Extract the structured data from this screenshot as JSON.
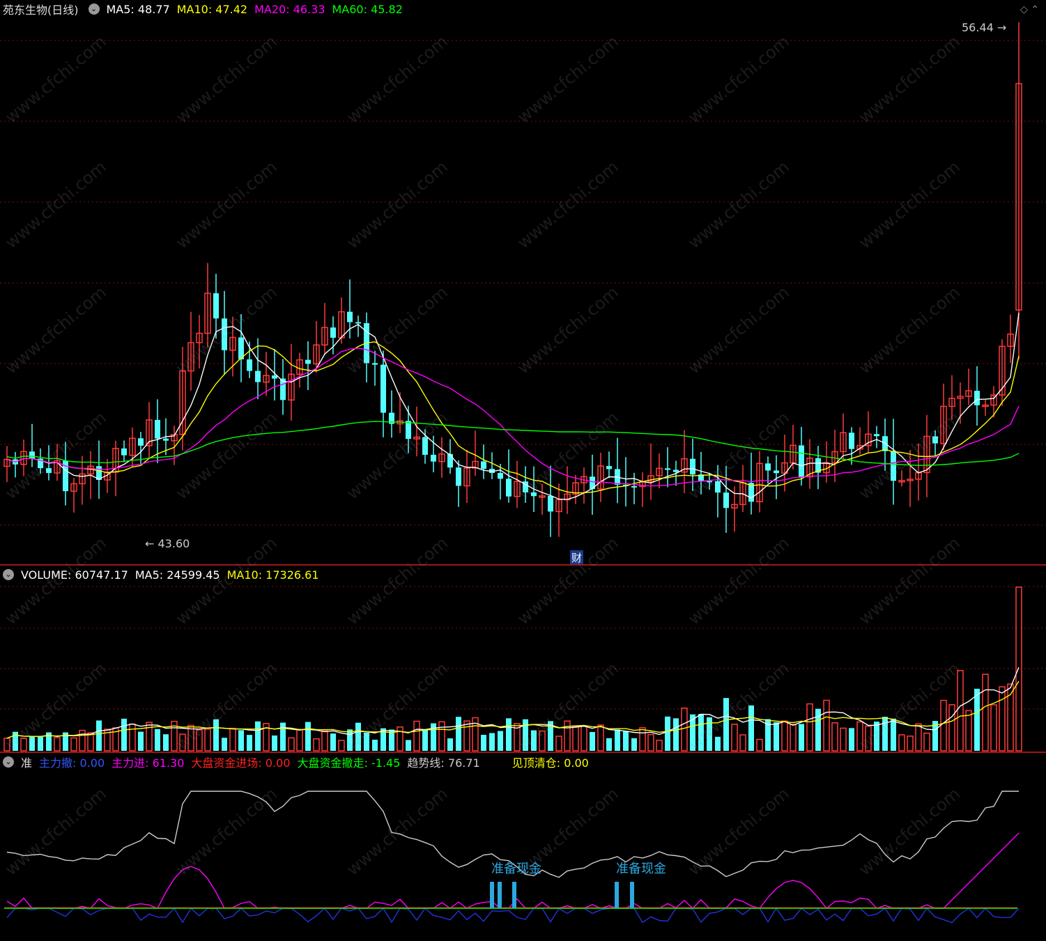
{
  "price_panel": {
    "title": "苑东生物(日线)",
    "ma_labels": [
      {
        "text": "MA5: 48.77",
        "color": "#ffffff"
      },
      {
        "text": "MA10: 47.42",
        "color": "#ffff00"
      },
      {
        "text": "MA20: 46.33",
        "color": "#ff00ff"
      },
      {
        "text": "MA60: 45.82",
        "color": "#00ff00"
      }
    ],
    "high_label": "56.44",
    "low_label": "43.60",
    "finance_badge": "财"
  },
  "volume_panel": {
    "labels": [
      {
        "text": "VOLUME: 60747.17",
        "color": "#ffffff"
      },
      {
        "text": "MA5: 24599.45",
        "color": "#ffffff"
      },
      {
        "text": "MA10: 17326.61",
        "color": "#ffff00"
      }
    ]
  },
  "indicator_panel": {
    "name": "准",
    "labels": [
      {
        "text": "主力撤: 0.00",
        "color": "#3355ff"
      },
      {
        "text": "主力进: 61.30",
        "color": "#ff00ff"
      },
      {
        "text": "大盘资金进场: 0.00",
        "color": "#ff2222"
      },
      {
        "text": "大盘资金撤走: -1.45",
        "color": "#00ff00"
      },
      {
        "text": "趋势线: 76.71",
        "color": "#cccccc"
      },
      {
        "text": "见顶清仓: 0.00",
        "color": "#ffff00"
      }
    ],
    "signal_label_1": "准备现金",
    "signal_label_2": "准备现金"
  },
  "watermark": "www.cfchi.com",
  "colors": {
    "up": "#ff3a3a",
    "down": "#55ffff",
    "grid": "#801010",
    "ma5": "#ffffff",
    "ma10": "#ffff00",
    "ma20": "#ff00ff",
    "ma60": "#00ff00"
  }
}
